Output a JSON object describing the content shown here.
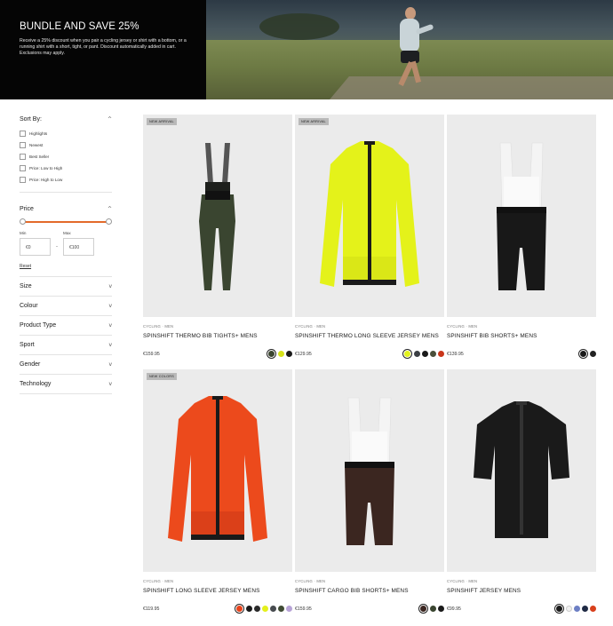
{
  "banner": {
    "title": "BUNDLE AND SAVE 25%",
    "text": "Receive a 25% discount when you pair a cycling jersey or shirt with a bottom, or a running shirt with a short, tight, or pant. Discount automatically added in cart. Exclusions may apply."
  },
  "sidebar": {
    "sort_title": "Sort By:",
    "sort_options": [
      "Highlights",
      "Newest",
      "Best Seller",
      "Price: Low to High",
      "Price: High to Low"
    ],
    "price_title": "Price",
    "min_label": "Min",
    "max_label": "Max",
    "min_value": "€0",
    "max_value": "€100",
    "separator": "-",
    "reset": "Reset",
    "facets": [
      "Size",
      "Colour",
      "Product Type",
      "Sport",
      "Gender",
      "Technology"
    ],
    "chevron_up": "^",
    "chevron_down": "v"
  },
  "products": [
    {
      "badge": "NEW ARRIVAL",
      "category": "CYCLING · MEN",
      "name": "SPINSHIFT THERMO BIB TIGHTS+ MENS",
      "price": "€159.95",
      "image": "bib-tights-icon",
      "swatches": [
        "#3a4530",
        "#d6e21a",
        "#1a1a1a"
      ],
      "selected": 0
    },
    {
      "badge": "NEW ARRIVAL",
      "category": "CYCLING · MEN",
      "name": "SPINSHIFT THERMO LONG SLEEVE JERSEY MENS",
      "price": "€129.95",
      "image": "jersey-long-sleeve-icon",
      "swatches": [
        "#e2f21c",
        "#3b3f44",
        "#1a1a1a",
        "#4a4f3a",
        "#c9361a"
      ],
      "selected": 0
    },
    {
      "badge": "",
      "category": "CYCLING · MEN",
      "name": "SPINSHIFT BIB SHORTS+ MENS",
      "price": "€139.95",
      "image": "bib-shorts-icon",
      "swatches": [
        "#1a1a1a",
        "#222222"
      ],
      "selected": 0
    },
    {
      "badge": "NEW COLORS",
      "category": "CYCLING · MEN",
      "name": "SPINSHIFT LONG SLEEVE JERSEY MENS",
      "price": "€119.95",
      "image": "jersey-long-sleeve-icon",
      "swatches": [
        "#e8421a",
        "#1a1a1a",
        "#2a2a2a",
        "#e4f01c",
        "#474b4f",
        "#3e4a33",
        "#b7a3d6"
      ],
      "selected": 0
    },
    {
      "badge": "",
      "category": "CYCLING · MEN",
      "name": "SPINSHIFT CARGO BIB SHORTS+ MENS",
      "price": "€159.95",
      "image": "bib-shorts-icon",
      "swatches": [
        "#3b2620",
        "#3a4530",
        "#1a1a1a"
      ],
      "selected": 0
    },
    {
      "badge": "",
      "category": "CYCLING · MEN",
      "name": "SPINSHIFT JERSEY MENS",
      "price": "€99.95",
      "image": "jersey-short-sleeve-icon",
      "swatches": [
        "#1a1a1a",
        "#f2f2f2",
        "#6d7fc4",
        "#1f2a44",
        "#d8401c"
      ],
      "selected": 0
    }
  ]
}
